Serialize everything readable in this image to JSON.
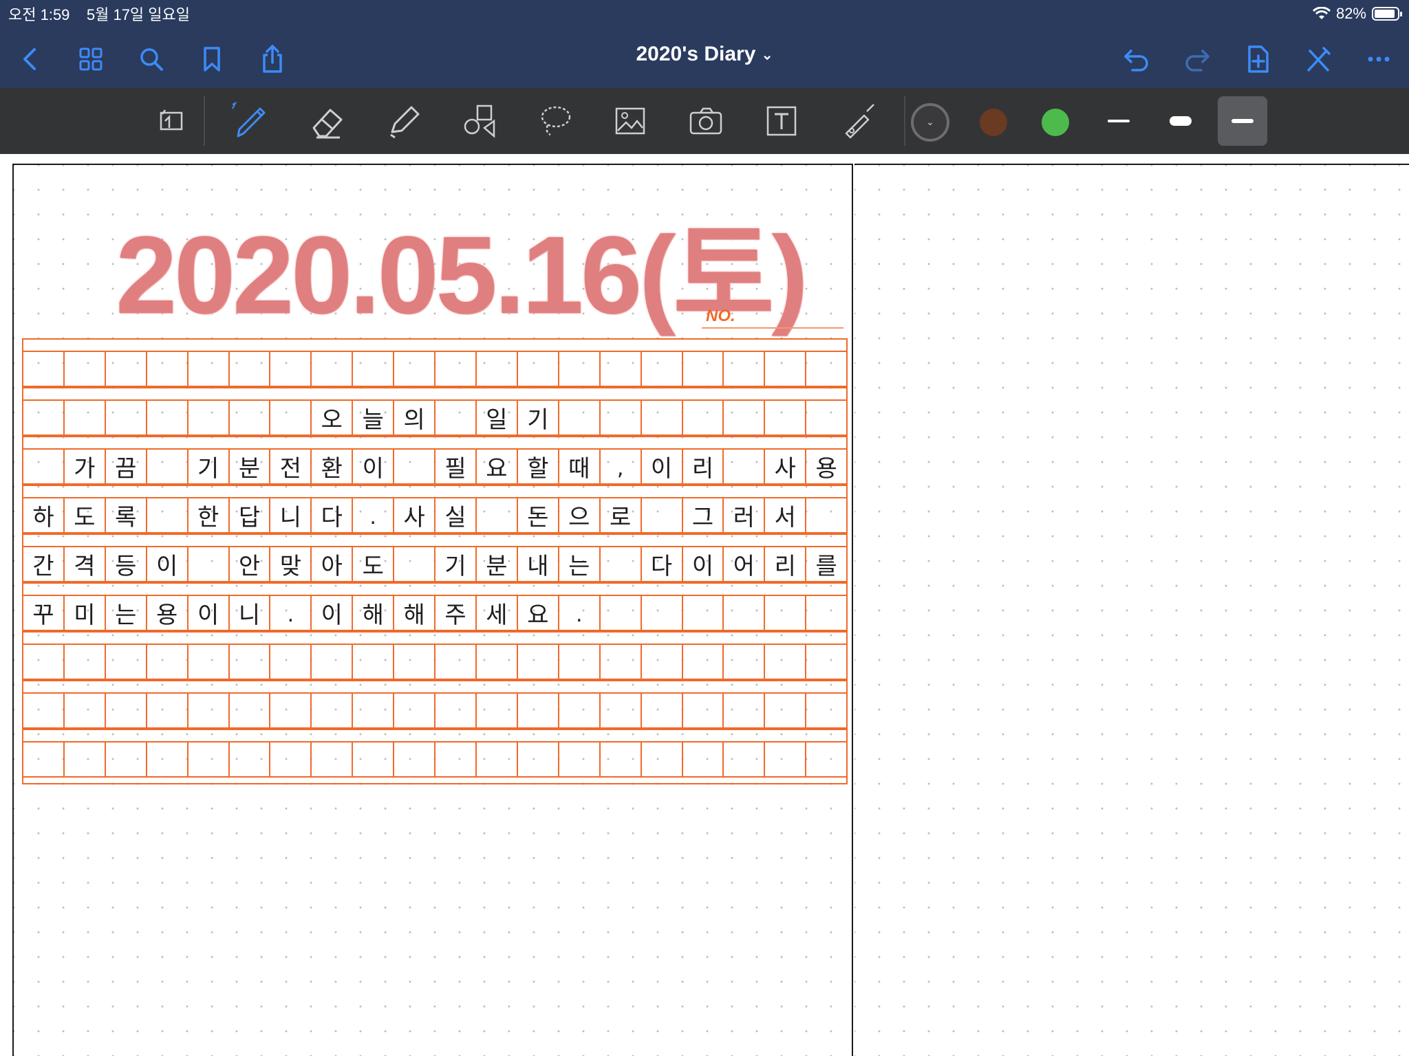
{
  "status_bar": {
    "time": "오전 1:59",
    "date": "5월 17일 일요일",
    "battery": "82%",
    "battery_level": 0.82
  },
  "nav": {
    "title": "2020's Diary",
    "title_dropdown_icon": "chevron-down-icon",
    "left_icons": [
      "back-icon",
      "thumbnails-icon",
      "search-icon",
      "bookmark-icon",
      "share-icon"
    ],
    "right_icons": [
      "undo-icon",
      "redo-icon",
      "add-page-icon",
      "close-ink-icon",
      "more-icon"
    ]
  },
  "toolbar": {
    "tools": [
      "read-only-icon",
      "pen-icon",
      "eraser-icon",
      "highlighter-icon",
      "shapes-icon",
      "lasso-icon",
      "image-icon",
      "camera-icon",
      "text-icon",
      "laser-pointer-icon"
    ],
    "selected_tool": "pen",
    "colors": [
      "#3a3a3c",
      "#6b3a22",
      "#4cbb4c"
    ],
    "stroke_sizes": [
      "thin",
      "thick",
      "medium"
    ],
    "selected_stroke": "medium"
  },
  "page": {
    "date_heading": "2020.05.16(토)",
    "no_label": "NO.",
    "grid_rows": [
      [
        "",
        "",
        "",
        "",
        "",
        "",
        "",
        "",
        "",
        "",
        "",
        "",
        "",
        "",
        "",
        "",
        "",
        "",
        "",
        ""
      ],
      [
        "",
        "",
        "",
        "",
        "",
        "",
        "",
        "오",
        "늘",
        "의",
        "",
        "일",
        "기",
        "",
        "",
        "",
        "",
        "",
        "",
        ""
      ],
      [
        "",
        "가",
        "끔",
        "",
        "기",
        "분",
        "전",
        "환",
        "이",
        "",
        "필",
        "요",
        "할",
        "때",
        ",",
        "이",
        "리",
        "",
        "사",
        "용"
      ],
      [
        "하",
        "도",
        "록",
        "",
        "한",
        "답",
        "니",
        "다",
        ".",
        "사",
        "실",
        "",
        "돈",
        "으",
        "로",
        "",
        "그",
        "러",
        "서",
        ""
      ],
      [
        "간",
        "격",
        "등",
        "이",
        "",
        "안",
        "맞",
        "아",
        "도",
        "",
        "기",
        "분",
        "내",
        "는",
        "",
        "다",
        "이",
        "어",
        "리",
        "를"
      ],
      [
        "꾸",
        "미",
        "는",
        "용",
        "이",
        "니",
        ".",
        "이",
        "해",
        "해",
        "주",
        "세",
        "요",
        ".",
        "",
        "",
        "",
        "",
        "",
        ""
      ],
      [
        "",
        "",
        "",
        "",
        "",
        "",
        "",
        "",
        "",
        "",
        "",
        "",
        "",
        "",
        "",
        "",
        "",
        "",
        "",
        ""
      ],
      [
        "",
        "",
        "",
        "",
        "",
        "",
        "",
        "",
        "",
        "",
        "",
        "",
        "",
        "",
        "",
        "",
        "",
        "",
        "",
        ""
      ],
      [
        "",
        "",
        "",
        "",
        "",
        "",
        "",
        "",
        "",
        "",
        "",
        "",
        "",
        "",
        "",
        "",
        "",
        "",
        "",
        ""
      ]
    ]
  }
}
